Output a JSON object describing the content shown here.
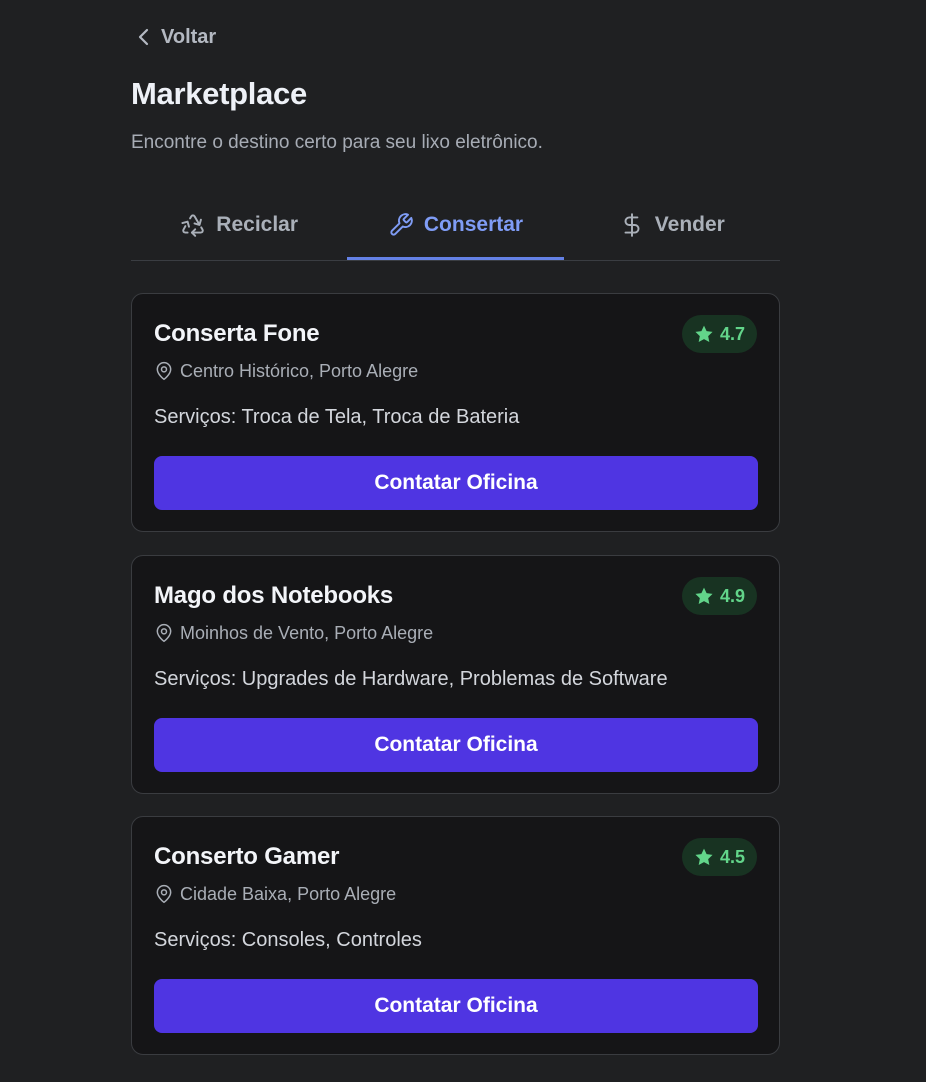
{
  "nav": {
    "back_label": "Voltar"
  },
  "header": {
    "title": "Marketplace",
    "subtitle": "Encontre o destino certo para seu lixo eletrônico."
  },
  "tabs": [
    {
      "label": "Reciclar",
      "icon": "recycle-icon",
      "active": false
    },
    {
      "label": "Consertar",
      "icon": "wrench-icon",
      "active": true
    },
    {
      "label": "Vender",
      "icon": "dollar-icon",
      "active": false
    }
  ],
  "shops": [
    {
      "name": "Conserta Fone",
      "rating": "4.7",
      "location": "Centro Histórico, Porto Alegre",
      "services": "Serviços: Troca de Tela, Troca de Bateria",
      "button_label": "Contatar Oficina"
    },
    {
      "name": "Mago dos Notebooks",
      "rating": "4.9",
      "location": "Moinhos de Vento, Porto Alegre",
      "services": "Serviços: Upgrades de Hardware, Problemas de Software",
      "button_label": "Contatar Oficina"
    },
    {
      "name": "Conserto Gamer",
      "rating": "4.5",
      "location": "Cidade Baixa, Porto Alegre",
      "services": "Serviços: Consoles, Controles",
      "button_label": "Contatar Oficina"
    }
  ],
  "colors": {
    "background": "#1f2022",
    "card_background": "#151517",
    "accent": "#7f9cf5",
    "button": "#4f35e2",
    "rating_text": "#62d58a",
    "rating_background": "#183322"
  }
}
